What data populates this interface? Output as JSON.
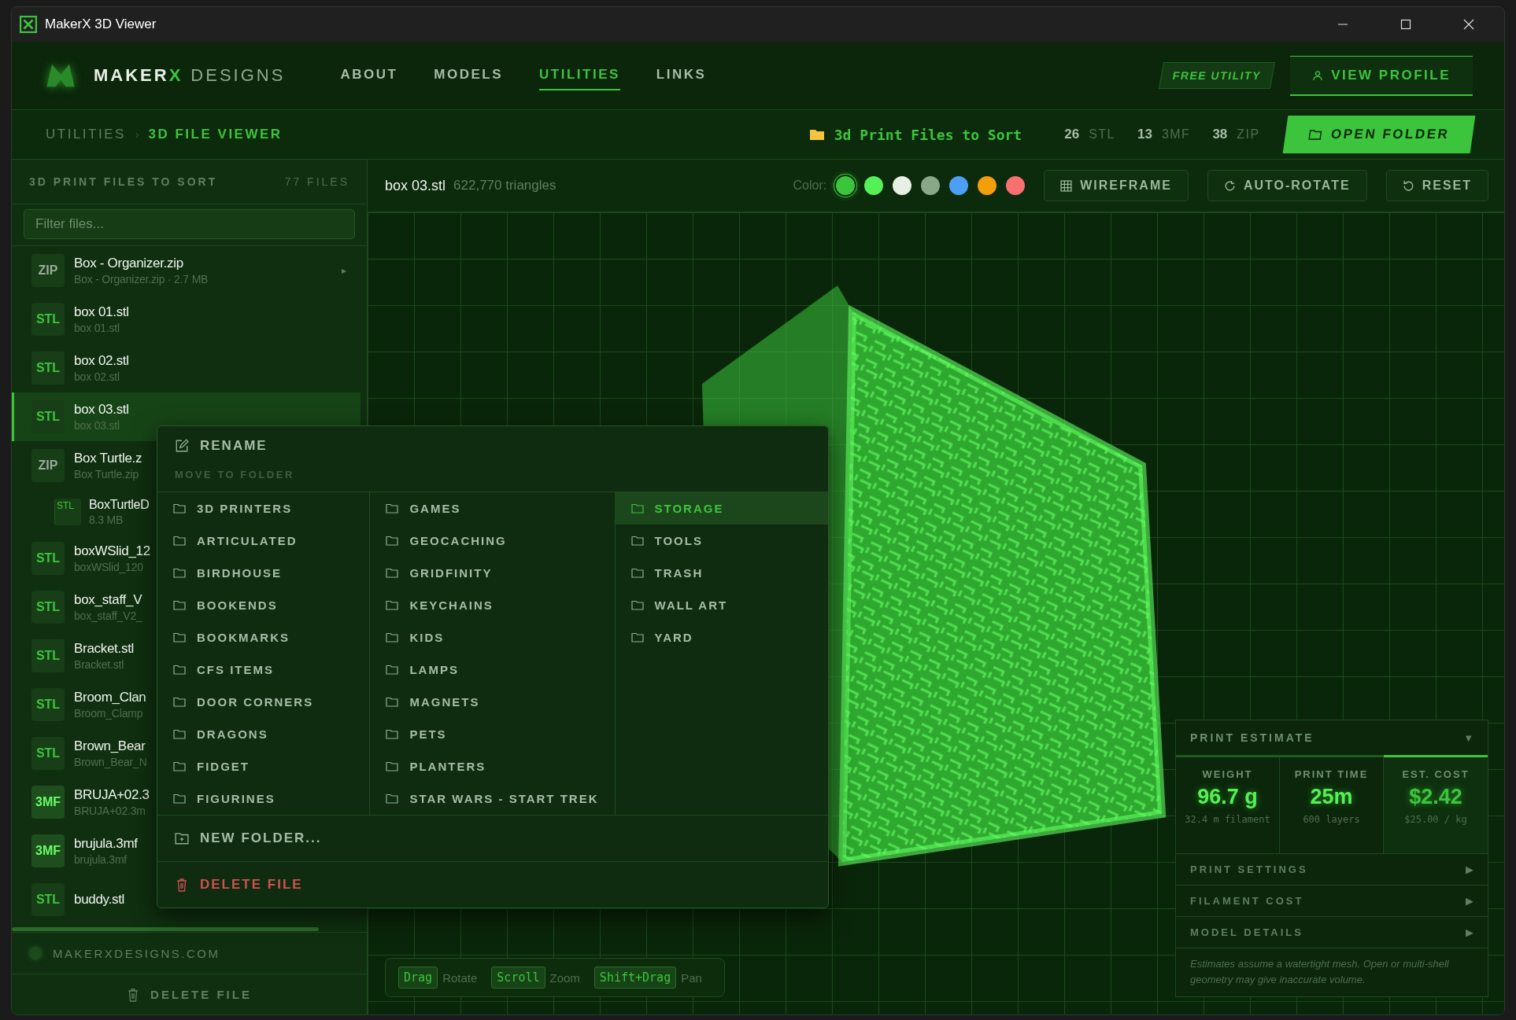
{
  "window": {
    "title": "MakerX 3D Viewer"
  },
  "header": {
    "brand": [
      {
        "text": "MAKER",
        "kind": "strong"
      },
      {
        "text": "X",
        "kind": "accent"
      },
      {
        "text": "DESIGNS",
        "kind": "light"
      }
    ],
    "nav": [
      {
        "label": "ABOUT",
        "selected": false
      },
      {
        "label": "MODELS",
        "selected": false
      },
      {
        "label": "UTILITIES",
        "selected": true
      },
      {
        "label": "LINKS",
        "selected": false
      }
    ],
    "badge": "FREE UTILITY",
    "profile_button": "VIEW PROFILE"
  },
  "breadcrumb": {
    "items": [
      "UTILITIES",
      "3D FILE VIEWER"
    ],
    "separator": "›"
  },
  "folder": {
    "name": "3d Print Files to Sort",
    "counts": [
      {
        "count": "26",
        "type": "STL"
      },
      {
        "count": "13",
        "type": "3MF"
      },
      {
        "count": "38",
        "type": "ZIP"
      }
    ],
    "open_button": "OPEN FOLDER"
  },
  "sidebar": {
    "title": "3D PRINT FILES TO SORT",
    "count": "77 FILES",
    "filter": {
      "placeholder": "Filter files..."
    },
    "files": [
      {
        "kind": "zip",
        "badge": "ZIP",
        "name": "Box - Organizer.zip",
        "sub": "Box - Organizer.zip · 2.7 MB",
        "selected": false,
        "toggle": "▸"
      },
      {
        "kind": "stl",
        "badge": "STL",
        "name": "box 01.stl",
        "sub": "box 01.stl",
        "selected": false
      },
      {
        "kind": "stl",
        "badge": "STL",
        "name": "box 02.stl",
        "sub": "box 02.stl",
        "selected": false
      },
      {
        "kind": "stl",
        "badge": "STL",
        "name": "box 03.stl",
        "sub": "box 03.stl",
        "selected": true
      },
      {
        "kind": "zip",
        "badge": "ZIP",
        "name": "Box Turtle.z",
        "sub": "Box Turtle.zip",
        "selected": false,
        "children": [
          {
            "kind": "stl",
            "badge": "STL",
            "name": "BoxTurtleD",
            "sub": "8.3 MB",
            "selected": false
          }
        ]
      },
      {
        "kind": "stl",
        "badge": "STL",
        "name": "boxWSlid_12",
        "sub": "boxWSlid_120",
        "selected": false
      },
      {
        "kind": "stl",
        "badge": "STL",
        "name": "box_staff_V",
        "sub": "box_staff_V2_",
        "selected": false
      },
      {
        "kind": "stl",
        "badge": "STL",
        "name": "Bracket.stl",
        "sub": "Bracket.stl",
        "selected": false
      },
      {
        "kind": "stl",
        "badge": "STL",
        "name": "Broom_Clan",
        "sub": "Broom_Clamp",
        "selected": false
      },
      {
        "kind": "stl",
        "badge": "STL",
        "name": "Brown_Bear",
        "sub": "Brown_Bear_N",
        "selected": false
      },
      {
        "kind": "project",
        "badge": "3MF",
        "name": "BRUJA+02.3",
        "sub": "BRUJA+02.3m",
        "selected": false
      },
      {
        "kind": "project",
        "badge": "3MF",
        "name": "brujula.3mf",
        "sub": "brujula.3mf",
        "selected": false
      },
      {
        "kind": "stl",
        "badge": "STL",
        "name": "buddy.stl",
        "selected": false
      }
    ],
    "site": "MAKERXDESIGNS.COM",
    "delete_button": "DELETE FILE"
  },
  "viewer": {
    "file": "box 03.stl",
    "triangles": "622,770 triangles",
    "color_label": "Color:",
    "swatches": [
      {
        "color": "#3dc43d",
        "selected": true
      },
      {
        "color": "#55f055",
        "selected": false
      },
      {
        "color": "#e8efe6",
        "selected": false
      },
      {
        "color": "#8aa888",
        "selected": false
      },
      {
        "color": "#4d9ff5",
        "selected": false
      },
      {
        "color": "#f59e0b",
        "selected": false
      },
      {
        "color": "#f87171",
        "selected": false
      }
    ],
    "buttons": [
      {
        "kind": "grid",
        "label": "WIREFRAME"
      },
      {
        "kind": "rotate",
        "label": "AUTO-ROTATE"
      },
      {
        "kind": "reset",
        "label": "RESET"
      }
    ],
    "hints": [
      {
        "key": "Drag",
        "action": "Rotate"
      },
      {
        "key": "Scroll",
        "action": "Zoom"
      },
      {
        "key": "Shift+Drag",
        "action": "Pan"
      }
    ]
  },
  "estimate": {
    "title": "PRINT ESTIMATE",
    "toggle": "▼",
    "stats": [
      {
        "label": "WEIGHT",
        "value": "96.7 g",
        "sub": "32.4 m filament",
        "selected": false
      },
      {
        "label": "PRINT TIME",
        "value": "25m",
        "sub": "600 layers",
        "selected": false
      },
      {
        "label": "EST. COST",
        "value": "$2.42",
        "sub": "$25.00 / kg",
        "selected": true
      }
    ],
    "sections": [
      {
        "label": "PRINT SETTINGS",
        "toggle": "▶"
      },
      {
        "label": "FILAMENT COST",
        "toggle": "▶"
      },
      {
        "label": "MODEL DETAILS",
        "toggle": "▶"
      }
    ],
    "note": "Estimates assume a watertight mesh. Open or multi-shell geometry may give inaccurate volume."
  },
  "context_menu": {
    "rename": "RENAME",
    "move_header": "MOVE TO FOLDER",
    "columns": [
      [
        {
          "label": "3D PRINTERS",
          "selected": false
        },
        {
          "label": "ARTICULATED",
          "selected": false
        },
        {
          "label": "BIRDHOUSE",
          "selected": false
        },
        {
          "label": "BOOKENDS",
          "selected": false
        },
        {
          "label": "BOOKMARKS",
          "selected": false
        },
        {
          "label": "CFS ITEMS",
          "selected": false
        },
        {
          "label": "DOOR CORNERS",
          "selected": false
        },
        {
          "label": "DRAGONS",
          "selected": false
        },
        {
          "label": "FIDGET",
          "selected": false
        },
        {
          "label": "FIGURINES",
          "selected": false
        }
      ],
      [
        {
          "label": "GAMES",
          "selected": false
        },
        {
          "label": "GEOCACHING",
          "selected": false
        },
        {
          "label": "GRIDFINITY",
          "selected": false
        },
        {
          "label": "KEYCHAINS",
          "selected": false
        },
        {
          "label": "KIDS",
          "selected": false
        },
        {
          "label": "LAMPS",
          "selected": false
        },
        {
          "label": "MAGNETS",
          "selected": false
        },
        {
          "label": "PETS",
          "selected": false
        },
        {
          "label": "PLANTERS",
          "selected": false
        },
        {
          "label": "STAR WARS - START TREK",
          "selected": false
        }
      ],
      [
        {
          "label": "STORAGE",
          "selected": true
        },
        {
          "label": "TOOLS",
          "selected": false
        },
        {
          "label": "TRASH",
          "selected": false
        },
        {
          "label": "WALL ART",
          "selected": false
        },
        {
          "label": "YARD",
          "selected": false
        }
      ]
    ],
    "new_folder": "NEW FOLDER...",
    "delete": "DELETE FILE"
  }
}
